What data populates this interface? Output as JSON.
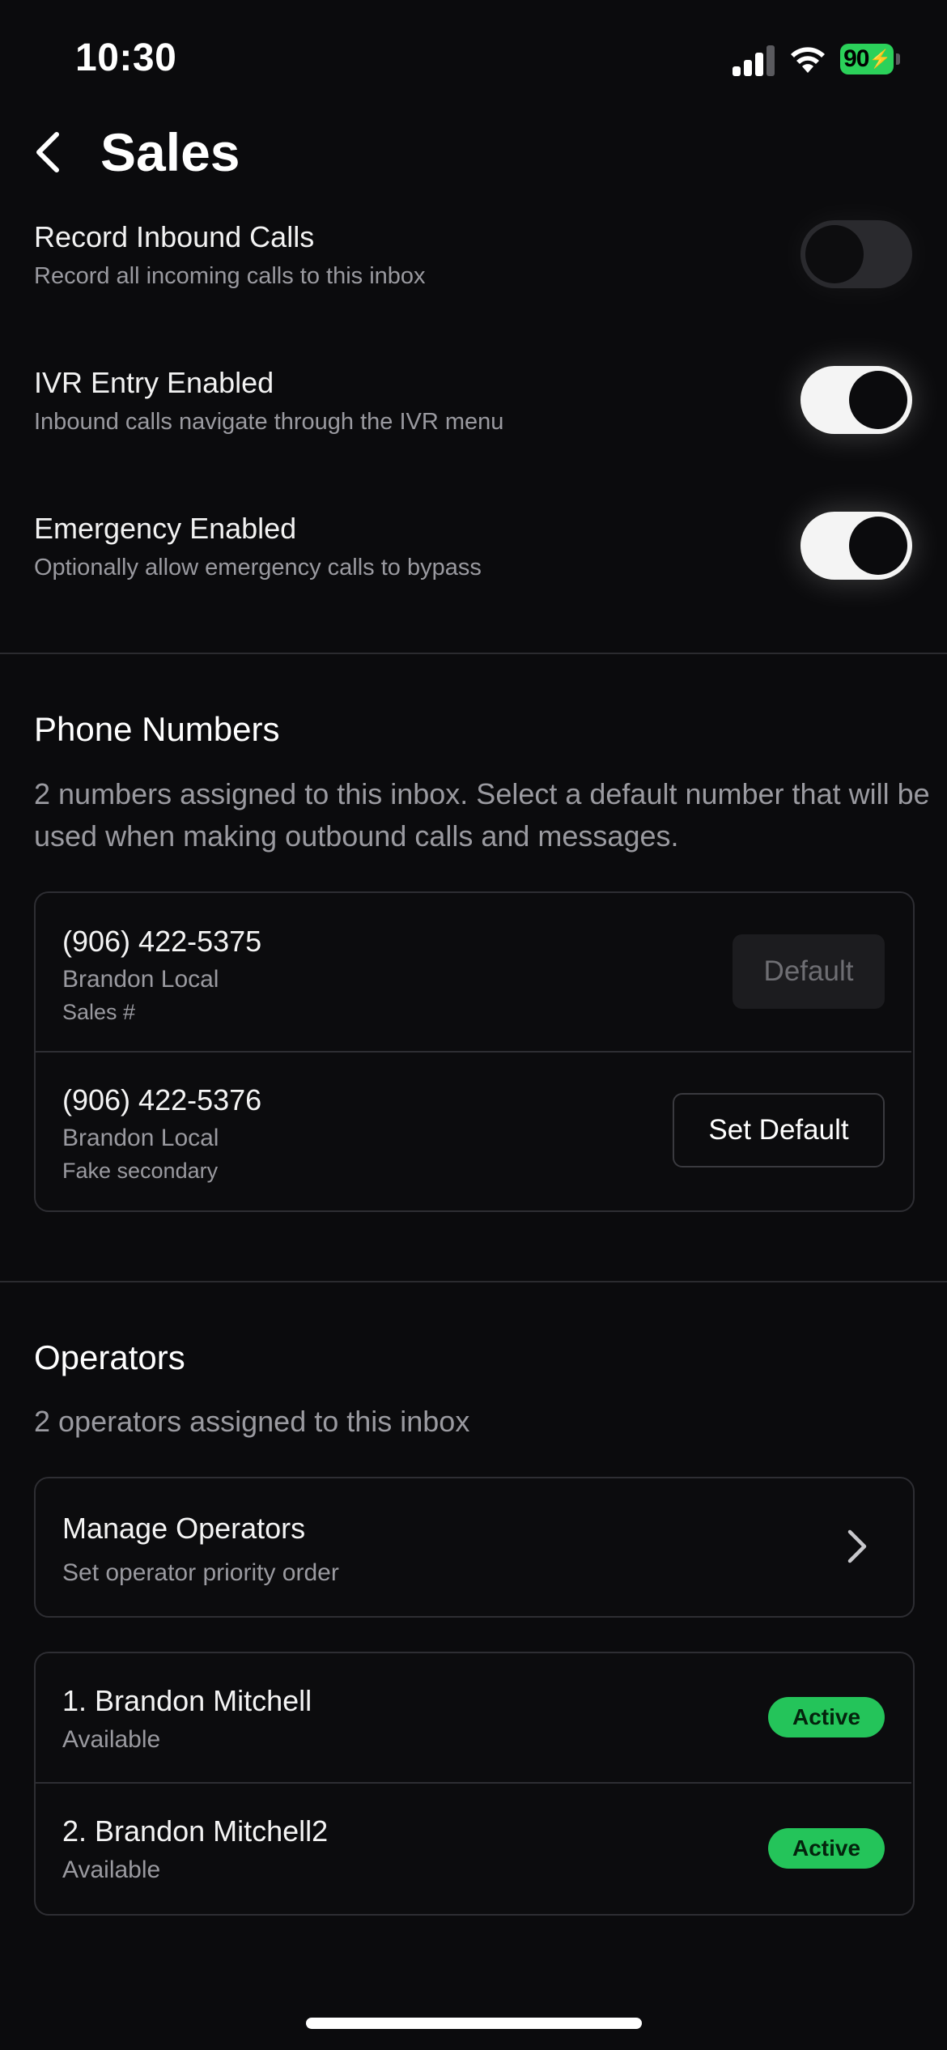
{
  "status_bar": {
    "time": "10:30",
    "battery": "90"
  },
  "header": {
    "title": "Sales"
  },
  "settings": [
    {
      "label": "Record Inbound Calls",
      "description": "Record all incoming calls to this inbox",
      "enabled": false
    },
    {
      "label": "IVR Entry Enabled",
      "description": "Inbound calls navigate through the IVR menu",
      "enabled": true
    },
    {
      "label": "Emergency Enabled",
      "description": "Optionally allow emergency calls to bypass",
      "enabled": true
    }
  ],
  "phone_numbers": {
    "title": "Phone Numbers",
    "description": "2 numbers assigned to this inbox. Select a default number that will be used when making outbound calls and messages.",
    "items": [
      {
        "number": "(906) 422-5375",
        "location": "Brandon Local",
        "note": "Sales #",
        "action": "Default"
      },
      {
        "number": "(906) 422-5376",
        "location": "Brandon Local",
        "note": "Fake secondary",
        "action": "Set Default"
      }
    ]
  },
  "operators": {
    "title": "Operators",
    "description": "2 operators assigned to this inbox",
    "manage": {
      "title": "Manage Operators",
      "subtitle": "Set operator priority order"
    },
    "items": [
      {
        "name": "1. Brandon Mitchell",
        "availability": "Available",
        "status": "Active"
      },
      {
        "name": "2. Brandon Mitchell2",
        "availability": "Available",
        "status": "Active"
      }
    ]
  },
  "colors": {
    "background": "#0b0b0d",
    "active_badge": "#24c45a",
    "battery": "#2bd15a"
  }
}
